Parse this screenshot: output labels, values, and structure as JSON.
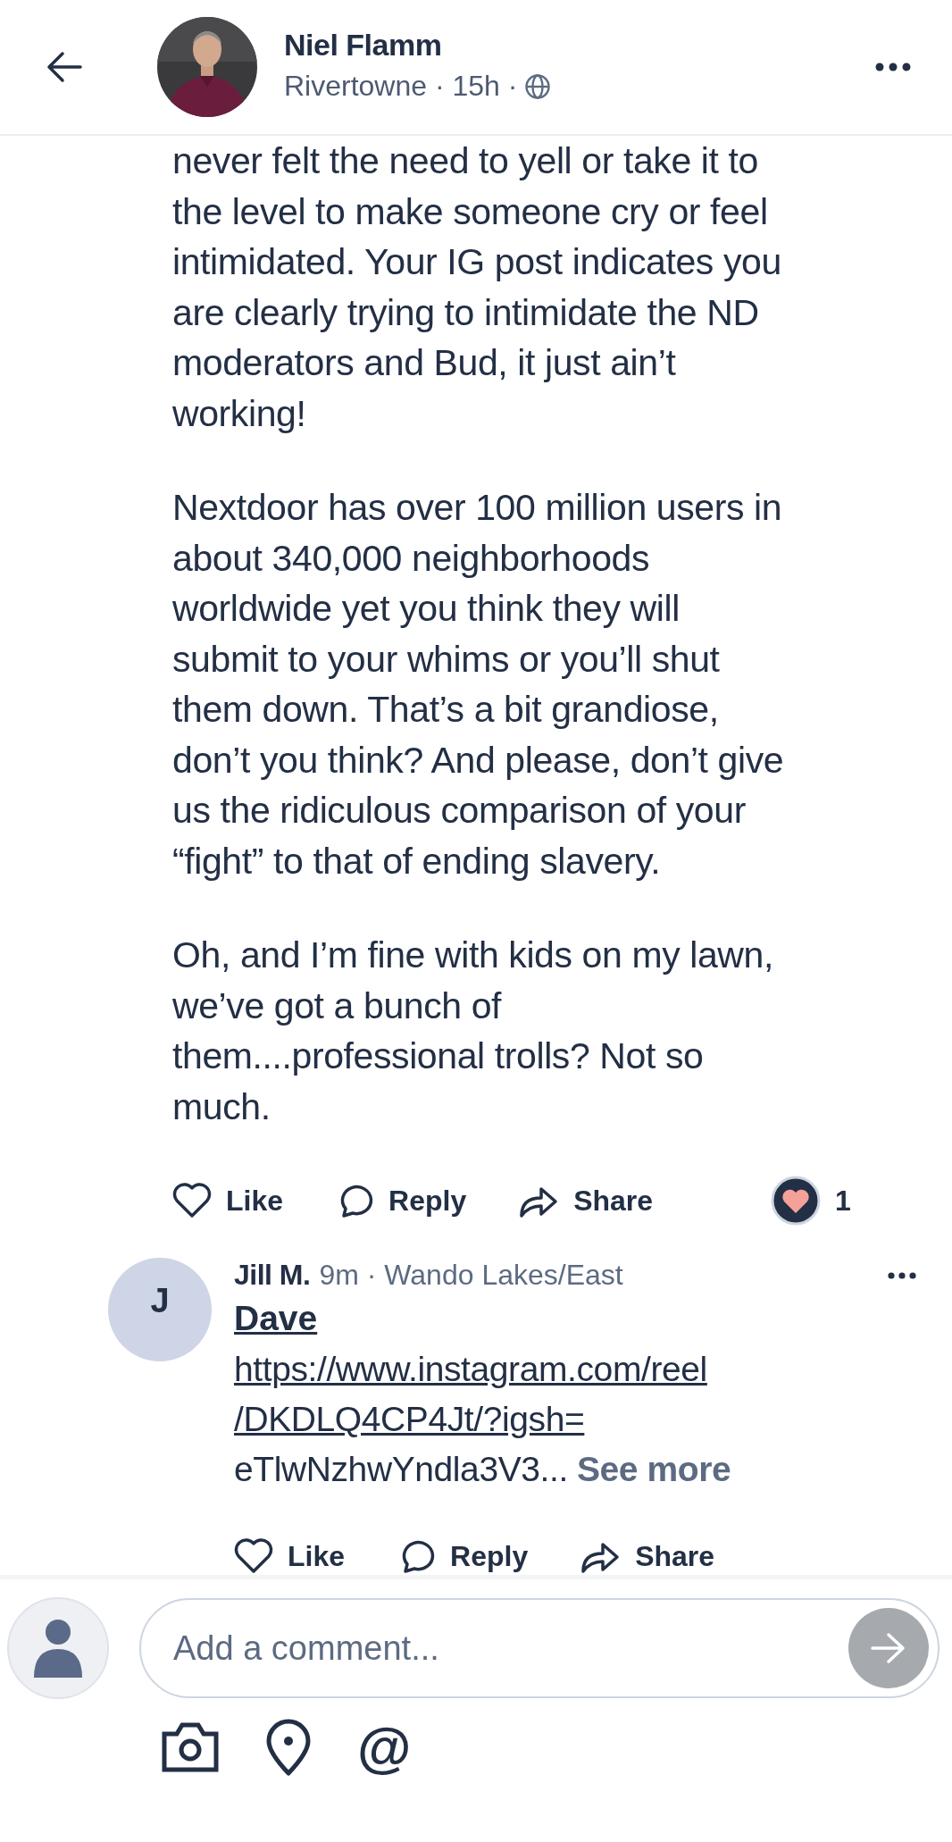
{
  "header": {
    "author": "Niel Flamm",
    "meta": "Rivertowne · 15h ·"
  },
  "post": {
    "paragraphs": [
      [
        "never felt the need to yell or take it to",
        "the level to make someone cry or feel",
        "intimidated. Your IG post indicates you",
        "are clearly trying to intimidate the ND",
        "moderators and Bud, it just ain’t",
        "working!"
      ],
      [
        "Nextdoor has over 100 million users in",
        "about 340,000 neighborhoods",
        "worldwide yet you think they will",
        "submit to your whims or you’ll shut",
        "them down. That’s a bit grandiose,",
        "don’t you think? And please, don’t give",
        "us the ridiculous comparison of your",
        "“fight” to that of ending slavery."
      ],
      [
        "Oh, and I’m fine with kids on my lawn,",
        "we’ve got a bunch of",
        "them....professional trolls? Not so",
        "much."
      ]
    ],
    "actions": [
      {
        "kind": "like",
        "label": "Like"
      },
      {
        "kind": "reply",
        "label": "Reply"
      },
      {
        "kind": "share",
        "label": "Share"
      }
    ],
    "reaction_count": "1"
  },
  "comment": {
    "initial": "J",
    "author": "Jill M.",
    "meta": "9m · Wando Lakes/East",
    "mention": "Dave",
    "link_lines": [
      "https://www.instagram.com/reel",
      "/DKDLQ4CP4Jt/?igsh="
    ],
    "excerpt": "eTlwNzhwYndla3V3...",
    "see_more": "See more",
    "actions": [
      {
        "kind": "like",
        "label": "Like"
      },
      {
        "kind": "reply",
        "label": "Reply"
      },
      {
        "kind": "share",
        "label": "Share"
      }
    ]
  },
  "composer": {
    "placeholder": "Add a comment...",
    "tools": [
      {
        "kind": "camera"
      },
      {
        "kind": "location"
      },
      {
        "kind": "mention",
        "symbol": "@"
      }
    ]
  }
}
